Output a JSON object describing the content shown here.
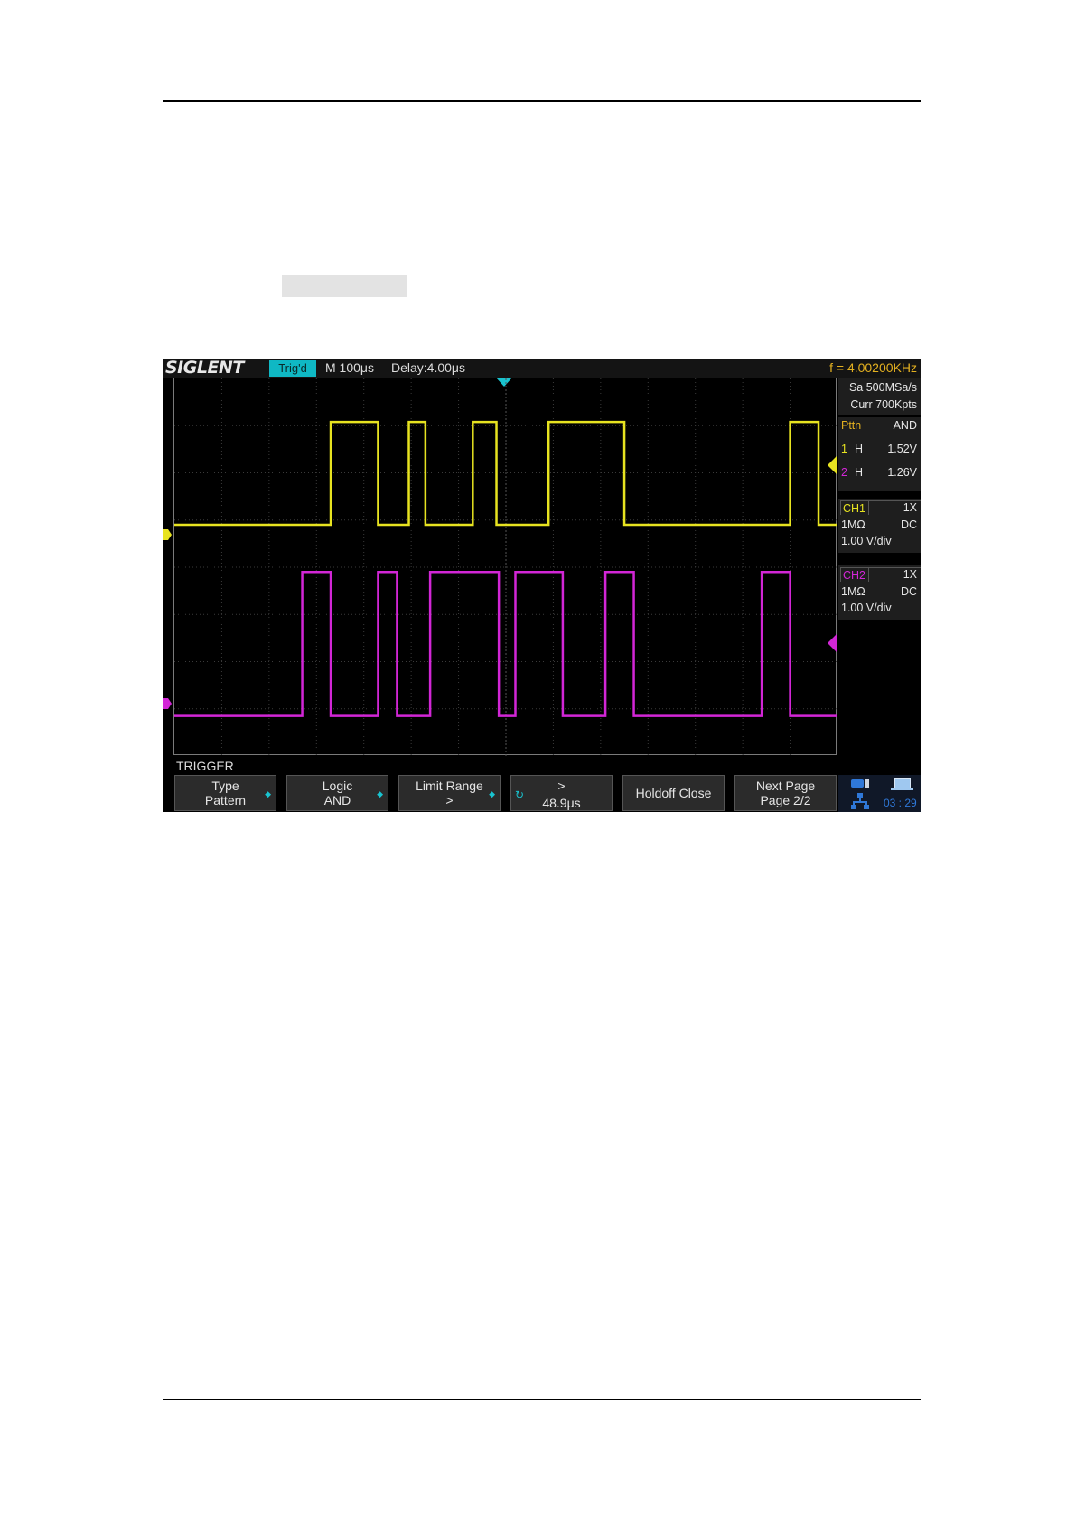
{
  "window": {
    "brand": "SIGLENT",
    "trigger_status": "Trig'd",
    "timebase": "M 100μs",
    "delay": "Delay:4.00μs",
    "frequency": "f = 4.00200KHz"
  },
  "acquisition": {
    "sample_rate": "Sa 500MSa/s",
    "memory": "Curr 700Kpts"
  },
  "pattern": {
    "label": "Pttn",
    "logic": "AND",
    "rows": [
      {
        "channel": "1",
        "state": "H",
        "level": "1.52V"
      },
      {
        "channel": "2",
        "state": "H",
        "level": "1.26V"
      }
    ]
  },
  "channels": [
    {
      "name": "CH1",
      "probe": "1X",
      "impedance": "1MΩ",
      "coupling": "DC",
      "scale": "1.00 V/div",
      "color": "#e7e320"
    },
    {
      "name": "CH2",
      "probe": "1X",
      "impedance": "1MΩ",
      "coupling": "DC",
      "scale": "1.00 V/div",
      "color": "#d226d6"
    }
  ],
  "waveforms": {
    "ch1_high_segments_div": [
      [
        3.3,
        4.3
      ],
      [
        4.95,
        5.3
      ],
      [
        6.3,
        6.8
      ],
      [
        7.9,
        9.5
      ],
      [
        13.0,
        13.6
      ]
    ],
    "ch2_high_segments_div": [
      [
        2.7,
        3.3
      ],
      [
        4.3,
        4.7
      ],
      [
        5.4,
        6.85
      ],
      [
        7.2,
        8.2
      ],
      [
        9.1,
        9.7
      ],
      [
        12.4,
        13.0
      ]
    ]
  },
  "menu": {
    "title": "TRIGGER",
    "softkeys": [
      {
        "line1": "Type",
        "line2": "Pattern"
      },
      {
        "line1": "Logic",
        "line2": "AND"
      },
      {
        "line1": "Limit Range",
        "line2": ">"
      },
      {
        "line1": ">",
        "line2": "48.9μs"
      },
      {
        "line1": "Holdoff Close",
        "line2": ""
      },
      {
        "line1": "Next Page",
        "line2": "Page 2/2"
      }
    ]
  },
  "status": {
    "clock": "03 : 29"
  }
}
